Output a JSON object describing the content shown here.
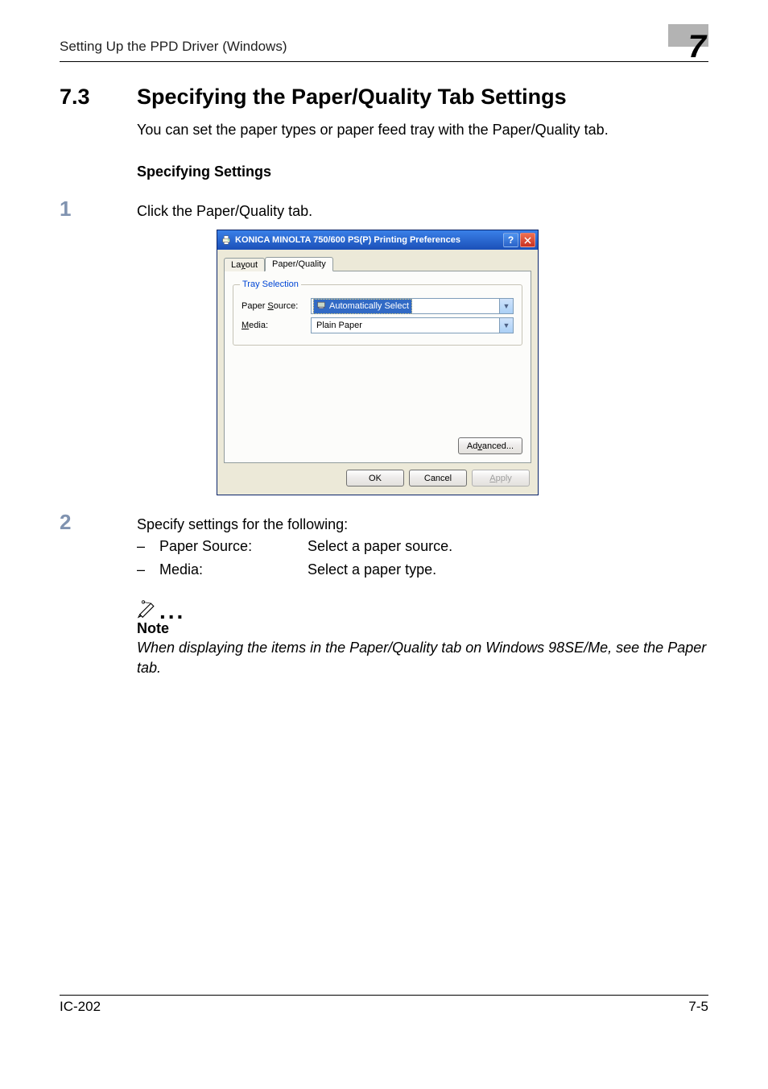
{
  "header": {
    "running_title": "Setting Up the PPD Driver (Windows)",
    "chapter_number": "7"
  },
  "section": {
    "number": "7.3",
    "title": "Specifying the Paper/Quality Tab Settings",
    "intro": "You can set the paper types or paper feed tray with the Paper/Quality tab.",
    "sub_heading": "Specifying Settings"
  },
  "steps": {
    "s1": {
      "num": "1",
      "text": "Click the Paper/Quality tab."
    },
    "s2": {
      "num": "2",
      "text": "Specify settings for the following:"
    }
  },
  "s2_items": {
    "paper_source": {
      "label": "Paper Source:",
      "desc": "Select a paper source."
    },
    "media": {
      "label": "Media:",
      "desc": "Select a paper type."
    }
  },
  "dialog": {
    "title": "KONICA MINOLTA 750/600 PS(P) Printing Preferences",
    "tabs": {
      "layout": "Layout",
      "paper_quality": "Paper/Quality"
    },
    "group_legend": "Tray Selection",
    "labels": {
      "paper_source": "Paper Source:",
      "media": "Media:"
    },
    "values": {
      "paper_source": "Automatically Select",
      "media": "Plain Paper"
    },
    "buttons": {
      "advanced": "Advanced...",
      "ok": "OK",
      "cancel": "Cancel",
      "apply": "Apply"
    }
  },
  "note": {
    "label": "Note",
    "text": "When displaying the items in the Paper/Quality tab on Windows 98SE/Me, see the Paper tab."
  },
  "footer": {
    "left": "IC-202",
    "right": "7-5"
  }
}
